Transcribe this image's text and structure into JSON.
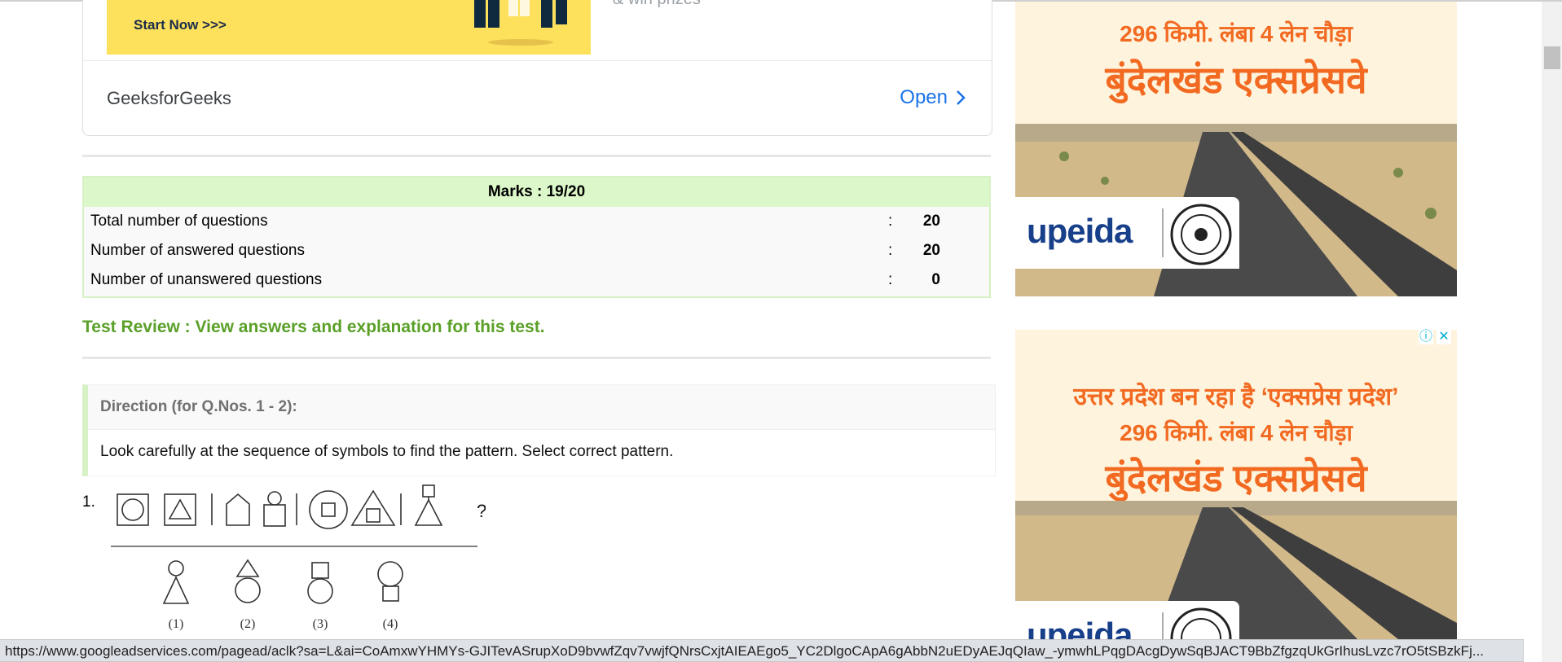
{
  "ad_top": {
    "start_label": "Start Now  >>>",
    "prizes_text": "& win prizes",
    "brand": "GeeksforGeeks",
    "open_label": "Open"
  },
  "marks": {
    "title": "Marks : 19/20",
    "rows": [
      {
        "label": "Total number of questions",
        "colon": ":",
        "value": "20"
      },
      {
        "label": "Number of answered questions",
        "colon": ":",
        "value": "20"
      },
      {
        "label": "Number of unanswered questions",
        "colon": ":",
        "value": "0"
      }
    ]
  },
  "review_link": "Test Review : View answers and explanation for this test.",
  "direction": {
    "title": "Direction (for Q.Nos. 1 - 2):",
    "text": "Look carefully at the sequence of symbols to find the pattern. Select correct pattern."
  },
  "question": {
    "number": "1.",
    "mark": "?",
    "options": [
      "(1)",
      "(2)",
      "(3)",
      "(4)"
    ]
  },
  "side_ad": {
    "line1": "उत्तर प्रदेश बन रहा है ‘एक्सप्रेस प्रदेश’",
    "line2": "296 किमी. लंबा 4 लेन चौड़ा",
    "line3": "बुंदेलखंड एक्सप्रेसवे",
    "logo": "upeida",
    "info_icon": "ⓘ",
    "close_icon": "✕"
  },
  "status_url": "https://www.googleadservices.com/pagead/aclk?sa=L&ai=CoAmxwYHMYs-GJITevASrupXoD9bvwfZqv7vwjfQNrsCxjtAIEAEgo5_YC2DlgoCApA6gAbbN2uEDyAEJqQIaw_-ymwhLPqgDAcgDywSqBJACT9BbZfgzqUkGrIhusLvzc7rO5tSBzkFj..."
}
